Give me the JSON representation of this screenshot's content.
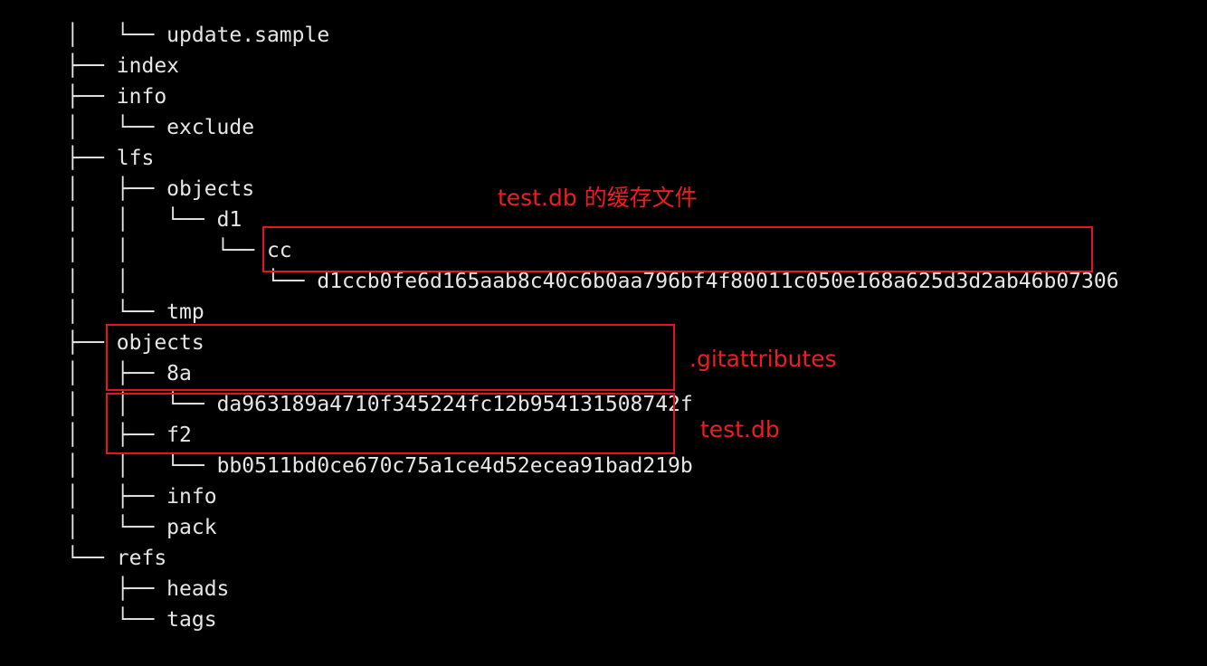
{
  "tree": [
    {
      "prefix": "│   └── ",
      "name": "update.sample"
    },
    {
      "prefix": "├── ",
      "name": "index"
    },
    {
      "prefix": "├── ",
      "name": "info"
    },
    {
      "prefix": "│   └── ",
      "name": "exclude"
    },
    {
      "prefix": "├── ",
      "name": "lfs"
    },
    {
      "prefix": "│   ├── ",
      "name": "objects"
    },
    {
      "prefix": "│   │   └── ",
      "name": "d1"
    },
    {
      "prefix": "│   │       └── ",
      "name": "cc"
    },
    {
      "prefix": "│   │           └── ",
      "name": "d1ccb0fe6d165aab8c40c6b0aa796bf4f80011c050e168a625d3d2ab46b07306"
    },
    {
      "prefix": "│   └── ",
      "name": "tmp"
    },
    {
      "prefix": "├── ",
      "name": "objects"
    },
    {
      "prefix": "│   ├── ",
      "name": "8a"
    },
    {
      "prefix": "│   │   └── ",
      "name": "da963189a4710f345224fc12b954131508742f"
    },
    {
      "prefix": "│   ├── ",
      "name": "f2"
    },
    {
      "prefix": "│   │   └── ",
      "name": "bb0511bd0ce670c75a1ce4d52ecea91bad219b"
    },
    {
      "prefix": "│   ├── ",
      "name": "info"
    },
    {
      "prefix": "│   └── ",
      "name": "pack"
    },
    {
      "prefix": "└── ",
      "name": "refs"
    },
    {
      "prefix": "    ├── ",
      "name": "heads"
    },
    {
      "prefix": "    └── ",
      "name": "tags"
    }
  ],
  "annotations": {
    "lfs_cache": "test.db 的缓存文件",
    "gitattributes": ".gitattributes",
    "testdb": "test.db"
  },
  "colors": {
    "background": "#000000",
    "text": "#e6e6e6",
    "highlight": "#e8141c"
  }
}
